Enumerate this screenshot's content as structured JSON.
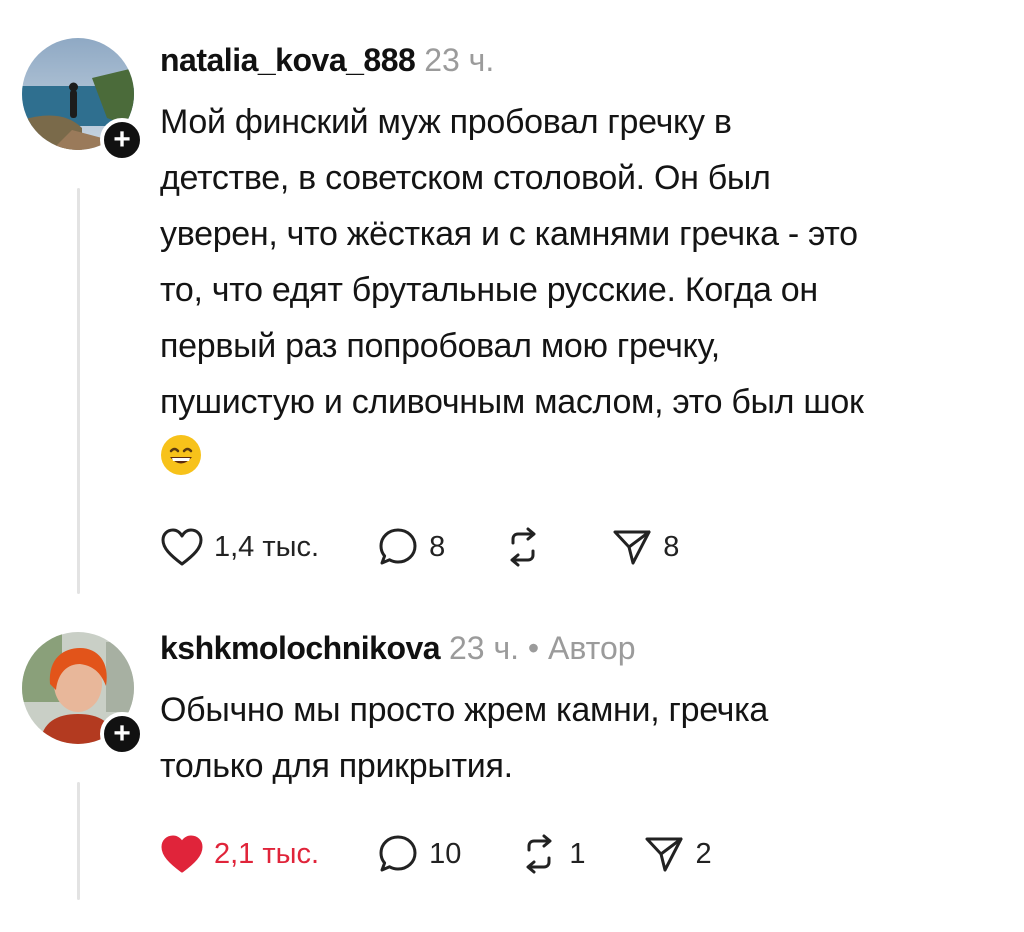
{
  "colors": {
    "liked_heart": "#e0243a",
    "meta_gray": "#9b9b9b",
    "thread_line": "#e3e3e3"
  },
  "comments": [
    {
      "username": "natalia_kova_888",
      "time": "23 ч.",
      "author_tag": "",
      "text_lines": [
        "Мой финский муж пробовал гречку в",
        "детстве, в советском столовой. Он был",
        "уверен, что  жёсткая и с камнями гречка - это",
        "то, что едят брутальные русские. Когда он",
        "первый раз попробовал мою гречку,",
        "пушистую и сливочным маслом, это был шок"
      ],
      "emoji": "grinning-face-with-smiling-eyes-emoji",
      "likes": "1,4 тыс.",
      "liked": false,
      "replies": "8",
      "reposts": "",
      "shares": "8"
    },
    {
      "username": "kshkmolochnikova",
      "time": "23 ч.",
      "author_tag": "• Автор",
      "text_lines": [
        "Обычно мы просто жрем камни, гречка",
        "только для прикрытия."
      ],
      "likes": "2,1 тыс.",
      "liked": true,
      "replies": "10",
      "reposts": "1",
      "shares": "2"
    }
  ],
  "icons": {
    "follow": "plus-icon",
    "like": "heart-icon",
    "reply": "comment-bubble-icon",
    "repost": "repost-arrows-icon",
    "share": "paper-plane-icon"
  },
  "follow_symbol": "+"
}
